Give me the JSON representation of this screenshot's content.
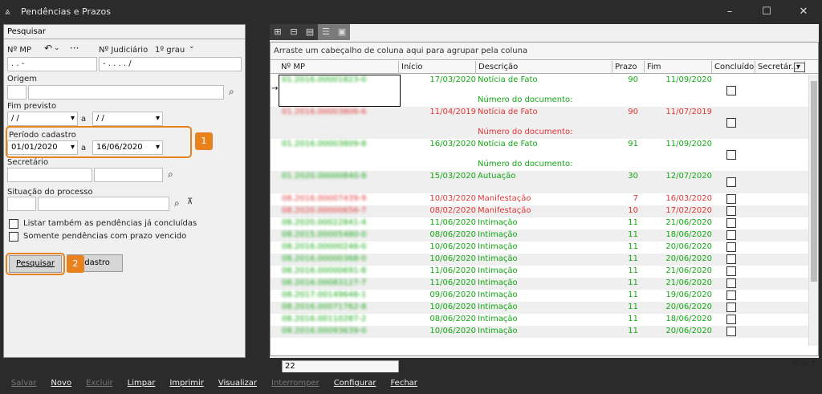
{
  "window": {
    "title": "Pendências e Prazos",
    "controls": [
      "–",
      "☐",
      "✕"
    ]
  },
  "search": {
    "header": "Pesquisar",
    "nmp_label": "Nº MP",
    "nmp_value": " .      .      -",
    "judiciario_label": "Nº Judiciário",
    "grau_label": "1º grau",
    "judiciario_value": "-  .   .   .  . /",
    "origem_label": "Origem",
    "fim_previsto_label": "Fim previsto",
    "fim_from": "/ /",
    "fim_to": "/ /",
    "a_label": "a",
    "periodo_label": "Período cadastro",
    "periodo_from": "01/01/2020",
    "periodo_to": "16/06/2020",
    "secretario_label": "Secretário",
    "situacao_label": "Situação do processo",
    "chk_concluidas": "Listar também as pendências já concluídas",
    "chk_vencido": "Somente pendências com prazo vencido",
    "pesquisar_btn": "Pesquisar",
    "cadastro_btn": "adastro",
    "badge1": "1",
    "badge2": "2"
  },
  "grid": {
    "group_hint": "Arraste um cabeçalho de coluna aqui para agrupar pela coluna",
    "columns": [
      "Nº MP",
      "Início",
      "Descrição",
      "Prazo",
      "Fim",
      "Concluído",
      "Secretár..."
    ],
    "doc_label": "Número do documento:",
    "rows": [
      {
        "mp": "01.2016.00001823-0",
        "inicio": "17/03/2020",
        "desc": "Notícia de Fato",
        "prazo": "90",
        "fim": "11/09/2020",
        "color": "green",
        "tall": true
      },
      {
        "mp": "01.2016.00003806-6",
        "inicio": "11/04/2019",
        "desc": "Notícia de Fato",
        "prazo": "90",
        "fim": "11/07/2019",
        "color": "red",
        "tall": true
      },
      {
        "mp": "01.2016.00003809-8",
        "inicio": "16/03/2020",
        "desc": "Notícia de Fato",
        "prazo": "91",
        "fim": "11/09/2020",
        "color": "green",
        "tall": true
      },
      {
        "mp": "01.2020.00000840-8",
        "inicio": "15/03/2020",
        "desc": "Autuação",
        "prazo": "30",
        "fim": "12/07/2020",
        "color": "green",
        "tall": false,
        "mid": true
      },
      {
        "mp": "08.2016.00007439-9",
        "inicio": "10/03/2020",
        "desc": "Manifestação",
        "prazo": "7",
        "fim": "16/03/2020",
        "color": "red"
      },
      {
        "mp": "08.2020.00000656-7",
        "inicio": "08/02/2020",
        "desc": "Manifestação",
        "prazo": "10",
        "fim": "17/02/2020",
        "color": "red"
      },
      {
        "mp": "08.2020.00022841-4",
        "inicio": "11/06/2020",
        "desc": "Intimação",
        "prazo": "11",
        "fim": "21/06/2020",
        "color": "green"
      },
      {
        "mp": "08.2015.00005480-0",
        "inicio": "08/06/2020",
        "desc": "Intimação",
        "prazo": "11",
        "fim": "18/06/2020",
        "color": "green"
      },
      {
        "mp": "08.2016.00000246-0",
        "inicio": "10/06/2020",
        "desc": "Intimação",
        "prazo": "11",
        "fim": "20/06/2020",
        "color": "green"
      },
      {
        "mp": "08.2016.00000368-0",
        "inicio": "10/06/2020",
        "desc": "Intimação",
        "prazo": "11",
        "fim": "20/06/2020",
        "color": "green"
      },
      {
        "mp": "08.2016.00000691-8",
        "inicio": "11/06/2020",
        "desc": "Intimação",
        "prazo": "11",
        "fim": "21/06/2020",
        "color": "green"
      },
      {
        "mp": "08.2016.00083127-7",
        "inicio": "11/06/2020",
        "desc": "Intimação",
        "prazo": "11",
        "fim": "21/06/2020",
        "color": "green"
      },
      {
        "mp": "08.2017.00149646-1",
        "inicio": "09/06/2020",
        "desc": "Intimação",
        "prazo": "11",
        "fim": "19/06/2020",
        "color": "green"
      },
      {
        "mp": "08.2016.00071762-8",
        "inicio": "10/06/2020",
        "desc": "Intimação",
        "prazo": "11",
        "fim": "20/06/2020",
        "color": "green"
      },
      {
        "mp": "08.2016.00110287-2",
        "inicio": "08/06/2020",
        "desc": "Intimação",
        "prazo": "11",
        "fim": "18/06/2020",
        "color": "green"
      },
      {
        "mp": "08.2016.00093639-0",
        "inicio": "10/06/2020",
        "desc": "Intimação",
        "prazo": "11",
        "fim": "20/06/2020",
        "color": "green"
      }
    ],
    "count": "22",
    "pager": "< > 1"
  },
  "bottom": {
    "items": [
      {
        "label": "Salvar",
        "enabled": false
      },
      {
        "label": "Novo",
        "enabled": true
      },
      {
        "label": "Excluir",
        "enabled": false
      },
      {
        "label": "Limpar",
        "enabled": true
      },
      {
        "label": "Imprimir",
        "enabled": true
      },
      {
        "label": "Visualizar",
        "enabled": true
      },
      {
        "label": "Interromper",
        "enabled": false
      },
      {
        "label": "Configurar",
        "enabled": true
      },
      {
        "label": "Fechar",
        "enabled": true
      }
    ]
  },
  "colors": {
    "accent": "#e8821e",
    "green": "#13a813",
    "red": "#e23535"
  }
}
